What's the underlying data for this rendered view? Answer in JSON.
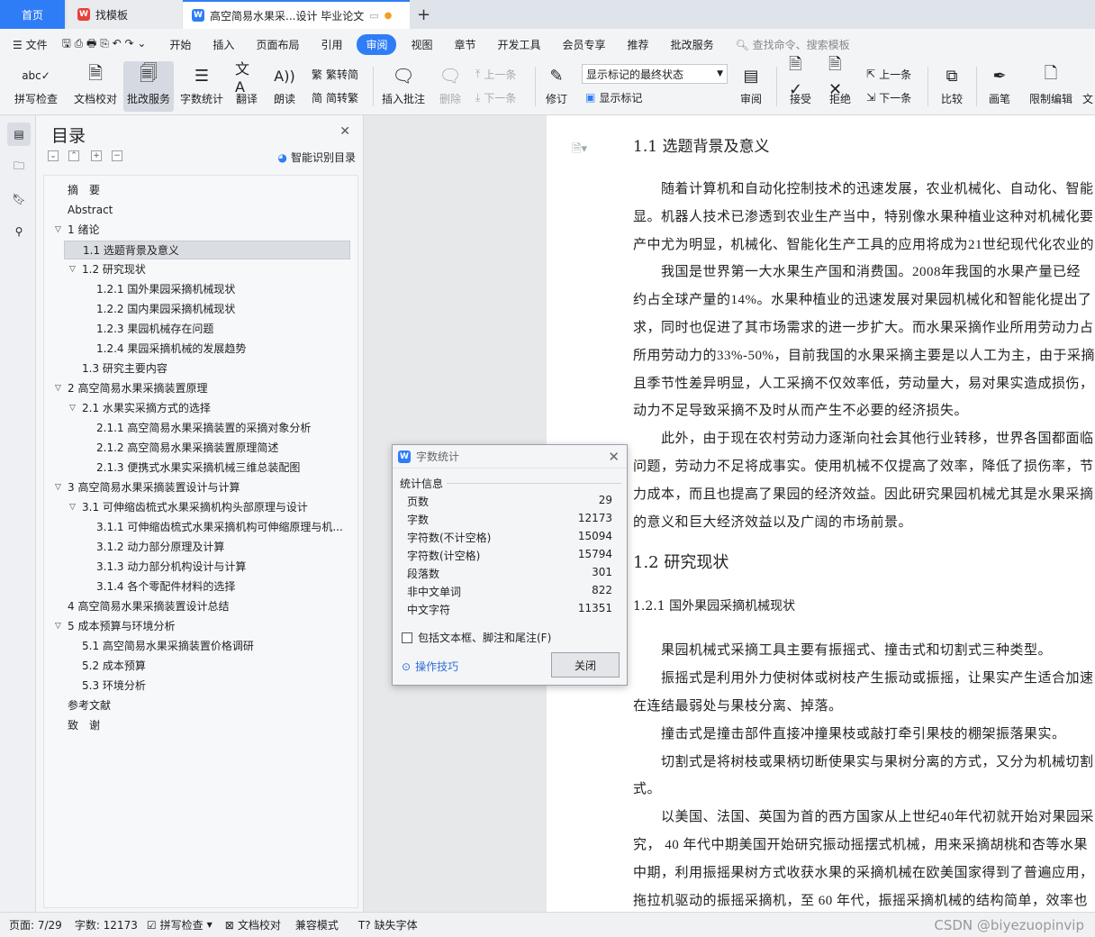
{
  "tabs": {
    "home": "首页",
    "templates": "找模板",
    "document": "高空简易水果采...设计 毕业论文"
  },
  "menu": {
    "file": "文件",
    "items": [
      "开始",
      "插入",
      "页面布局",
      "引用",
      "审阅",
      "视图",
      "章节",
      "开发工具",
      "会员专享",
      "推荐",
      "批改服务"
    ],
    "active": "审阅",
    "search": "查找命令、搜索模板"
  },
  "ribbon": {
    "spell": "拼写检查",
    "proofread": "文档校对",
    "correction": "批改服务",
    "wordcount": "字数统计",
    "translate": "翻译",
    "read": "朗读",
    "trad": "繁转简",
    "simp": "简转繁",
    "insert_comment": "插入批注",
    "delete": "删除",
    "prev": "上一条",
    "next": "下一条",
    "revise": "修订",
    "markup_state": "显示标记的最终状态",
    "show_markup": "显示标记",
    "review": "审阅",
    "accept": "接受",
    "reject": "拒绝",
    "prev2": "上一条",
    "next2": "下一条",
    "compare": "比较",
    "pen": "画笔",
    "restrict": "限制编辑",
    "doc_extra": "文"
  },
  "toc": {
    "title": "目录",
    "smart": "智能识别目录",
    "items": [
      {
        "text": "摘　要",
        "level": 0,
        "arrow": ""
      },
      {
        "text": "Abstract",
        "level": 0,
        "arrow": ""
      },
      {
        "text": "1  绪论",
        "level": 0,
        "arrow": "v"
      },
      {
        "text": "1.1  选题背景及意义",
        "level": 1,
        "arrow": ""
      },
      {
        "text": "1.2 研究现状",
        "level": 1,
        "arrow": "v"
      },
      {
        "text": "1.2.1 国外果园采摘机械现状",
        "level": 2,
        "arrow": ""
      },
      {
        "text": "1.2.2 国内果园采摘机械现状",
        "level": 2,
        "arrow": ""
      },
      {
        "text": "1.2.3 果园机械存在问题",
        "level": 2,
        "arrow": ""
      },
      {
        "text": "1.2.4 果园采摘机械的发展趋势",
        "level": 2,
        "arrow": ""
      },
      {
        "text": "1.3 研究主要内容",
        "level": 1,
        "arrow": ""
      },
      {
        "text": "2  高空简易水果采摘装置原理",
        "level": 0,
        "arrow": "v"
      },
      {
        "text": "2.1    水果实采摘方式的选择",
        "level": 1,
        "arrow": "v"
      },
      {
        "text": "2.1.1 高空简易水果采摘装置的采摘对象分析",
        "level": 2,
        "arrow": ""
      },
      {
        "text": "2.1.2 高空简易水果采摘装置原理简述",
        "level": 2,
        "arrow": ""
      },
      {
        "text": "2.1.3 便携式水果实采摘机械三维总装配图",
        "level": 2,
        "arrow": ""
      },
      {
        "text": "3  高空简易水果采摘装置设计与计算",
        "level": 0,
        "arrow": "v"
      },
      {
        "text": "3.1 可伸缩齿梳式水果采摘机构头部原理与设计",
        "level": 1,
        "arrow": "v"
      },
      {
        "text": "3.1.1 可伸缩齿梳式水果采摘机构可伸缩原理与机...",
        "level": 2,
        "arrow": ""
      },
      {
        "text": "3.1.2 动力部分原理及计算",
        "level": 2,
        "arrow": ""
      },
      {
        "text": "3.1.3 动力部分机构设计与计算",
        "level": 2,
        "arrow": ""
      },
      {
        "text": "3.1.4 各个零配件材料的选择",
        "level": 2,
        "arrow": ""
      },
      {
        "text": "4  高空简易水果采摘装置设计总结",
        "level": 0,
        "arrow": ""
      },
      {
        "text": "5  成本预算与环境分析",
        "level": 0,
        "arrow": "v"
      },
      {
        "text": "5.1  高空简易水果采摘装置价格调研",
        "level": 1,
        "arrow": ""
      },
      {
        "text": "5.2  成本预算",
        "level": 1,
        "arrow": ""
      },
      {
        "text": "5.3  环境分析",
        "level": 1,
        "arrow": ""
      },
      {
        "text": "参考文献",
        "level": 0,
        "arrow": ""
      },
      {
        "text": "致　谢",
        "level": 0,
        "arrow": ""
      }
    ],
    "selected": 3
  },
  "document": {
    "lines": [
      {
        "t": "1.1  选题背景及意义",
        "kind": "h2"
      },
      {
        "t": "　　随着计算机和自动化控制技术的迅速发展，农业机械化、自动化、智能",
        "kind": "p"
      },
      {
        "t": "显。机器人技术已渗透到农业生产当中，特别像水果种植业这种对机械化要",
        "kind": "p"
      },
      {
        "t": "产中尤为明显，机械化、智能化生产工具的应用将成为21世纪现代化农业的",
        "kind": "p"
      },
      {
        "t": "　　我国是世界第一大水果生产国和消费国。2008年我国的水果产量已经",
        "kind": "p"
      },
      {
        "t": "约占全球产量的14%。水果种植业的迅速发展对果园机械化和智能化提出了",
        "kind": "p"
      },
      {
        "t": "求，同时也促进了其市场需求的进一步扩大。而水果采摘作业所用劳动力占",
        "kind": "p"
      },
      {
        "t": "所用劳动力的33%-50%，目前我国的水果采摘主要是以人工为主，由于采摘",
        "kind": "p"
      },
      {
        "t": "且季节性差异明显，人工采摘不仅效率低，劳动量大，易对果实造成损伤，",
        "kind": "p"
      },
      {
        "t": "动力不足导致采摘不及时从而产生不必要的经济损失。",
        "kind": "p"
      },
      {
        "t": "　　此外，由于现在农村劳动力逐渐向社会其他行业转移，世界各国都面临",
        "kind": "p"
      },
      {
        "t": "问题，劳动力不足将成事实。使用机械不仅提高了效率，降低了损伤率，节",
        "kind": "p"
      },
      {
        "t": "力成本，而且也提高了果园的经济效益。因此研究果园机械尤其是水果采摘",
        "kind": "p"
      },
      {
        "t": "的意义和巨大经济效益以及广阔的市场前景。",
        "kind": "p"
      },
      {
        "t": "1.2 研究现状",
        "kind": "h1"
      },
      {
        "t": "1.2.1 国外果园采摘机械现状",
        "kind": "h3"
      },
      {
        "t": "　　果园机械式采摘工具主要有振摇式、撞击式和切割式三种类型。",
        "kind": "p"
      },
      {
        "t": "　　振摇式是利用外力使树体或树枝产生振动或振摇，让果实产生适合加速",
        "kind": "p"
      },
      {
        "t": "在连结最弱处与果枝分离、掉落。",
        "kind": "p"
      },
      {
        "t": "　　撞击式是撞击部件直接冲撞果枝或敲打牵引果枝的棚架振落果实。",
        "kind": "p"
      },
      {
        "t": "　　切割式是将树枝或果柄切断使果实与果树分离的方式，又分为机械切割",
        "kind": "p"
      },
      {
        "t": "式。",
        "kind": "p"
      },
      {
        "t": "　　以美国、法国、英国为首的西方国家从上世纪40年代初就开始对果园采",
        "kind": "p"
      },
      {
        "t": "究，  40 年代中期美国开始研究振动摇摆式机械，用来采摘胡桃和杏等水果",
        "kind": "p"
      },
      {
        "t": "中期，利用振摇果树方式收获水果的采摘机械在欧美国家得到了普遍应用，",
        "kind": "p"
      },
      {
        "t": "拖拉机驱动的振摇采摘机，至 60 年代，振摇采摘机械的结构简单，效率也",
        "kind": "p"
      }
    ]
  },
  "dialog": {
    "title": "字数统计",
    "group": "统计信息",
    "rows": [
      {
        "label": "页数",
        "value": "29"
      },
      {
        "label": "字数",
        "value": "12173"
      },
      {
        "label": "字符数(不计空格)",
        "value": "15094"
      },
      {
        "label": "字符数(计空格)",
        "value": "15794"
      },
      {
        "label": "段落数",
        "value": "301"
      },
      {
        "label": "非中文单词",
        "value": "822"
      },
      {
        "label": "中文字符",
        "value": "11351"
      }
    ],
    "checkbox": "包括文本框、脚注和尾注(F)",
    "tips": "操作技巧",
    "close": "关闭"
  },
  "status": {
    "page": "页面: 7/29",
    "words": "字数: 12173",
    "spell": "拼写检查",
    "proof": "文档校对",
    "compat": "兼容模式",
    "missing_font": "缺失字体"
  },
  "watermark": "CSDN @biyezuopinvip",
  "colors": {
    "accent": "#2f7df6",
    "wps_red": "#e8403a"
  }
}
